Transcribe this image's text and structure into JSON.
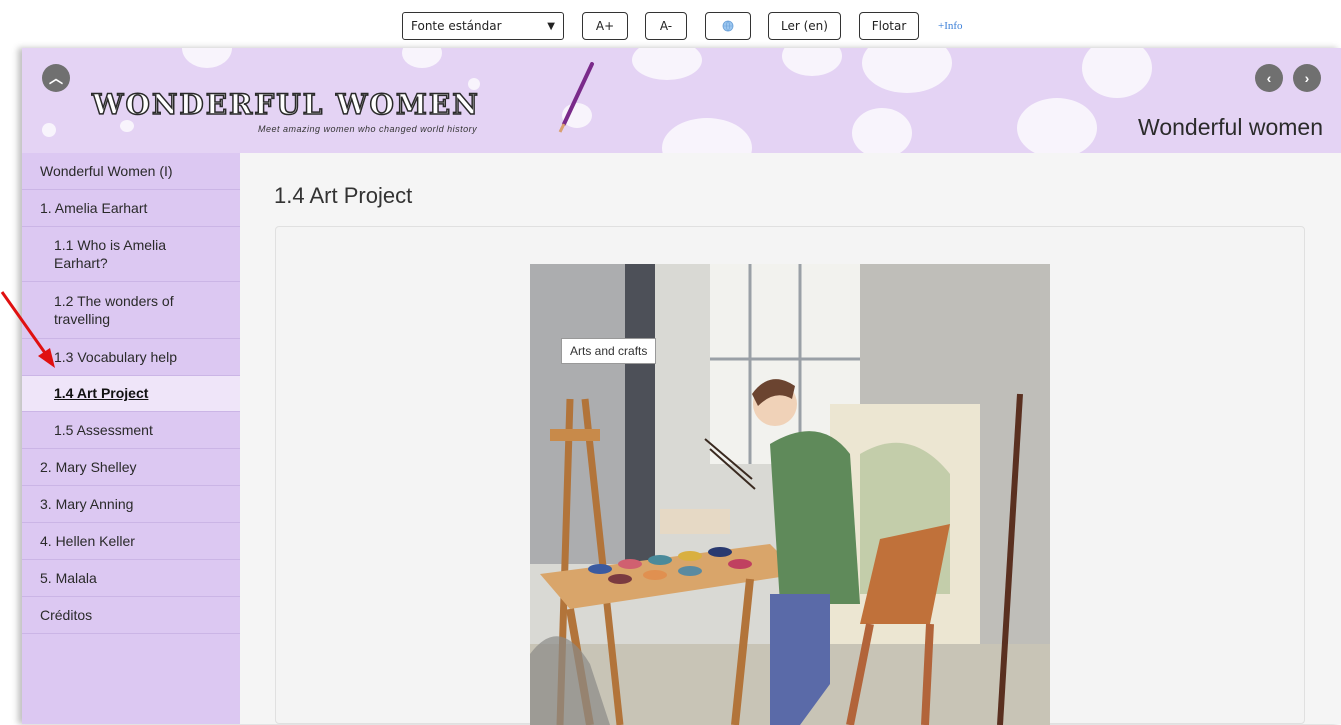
{
  "toolbar": {
    "font_select_value": "Fonte estándar",
    "increase_font_label": "A+",
    "decrease_font_label": "A-",
    "read_label": "Ler (en)",
    "float_label": "Flotar",
    "info_link": "+Info"
  },
  "header": {
    "logo_title": "WONDERFUL WOMEN",
    "logo_subtitle": "Meet amazing women who changed world history",
    "page_header_title": "Wonderful women",
    "background_color": "#e4d3f4"
  },
  "sidebar": {
    "items": [
      {
        "label": "Wonderful Women (I)",
        "level": 0,
        "active": false
      },
      {
        "label": "1. Amelia Earhart",
        "level": 0,
        "active": false
      },
      {
        "label": "1.1 Who is Amelia Earhart?",
        "level": 1,
        "active": false
      },
      {
        "label": "1.2 The wonders of travelling",
        "level": 1,
        "active": false
      },
      {
        "label": "1.3 Vocabulary help",
        "level": 1,
        "active": false
      },
      {
        "label": "1.4 Art Project",
        "level": 1,
        "active": true
      },
      {
        "label": "1.5 Assessment",
        "level": 1,
        "active": false
      },
      {
        "label": "2. Mary Shelley",
        "level": 0,
        "active": false
      },
      {
        "label": "3. Mary Anning",
        "level": 0,
        "active": false
      },
      {
        "label": "4. Hellen Keller",
        "level": 0,
        "active": false
      },
      {
        "label": "5. Malala",
        "level": 0,
        "active": false
      },
      {
        "label": "Créditos",
        "level": 0,
        "active": false
      }
    ]
  },
  "main": {
    "page_title": "1.4 Art Project",
    "image_tooltip": "Arts and crafts"
  },
  "colors": {
    "sidebar_bg": "#dcc8f2",
    "active_item_bg": "#efe5f9",
    "annotation_arrow": "#e01010"
  }
}
